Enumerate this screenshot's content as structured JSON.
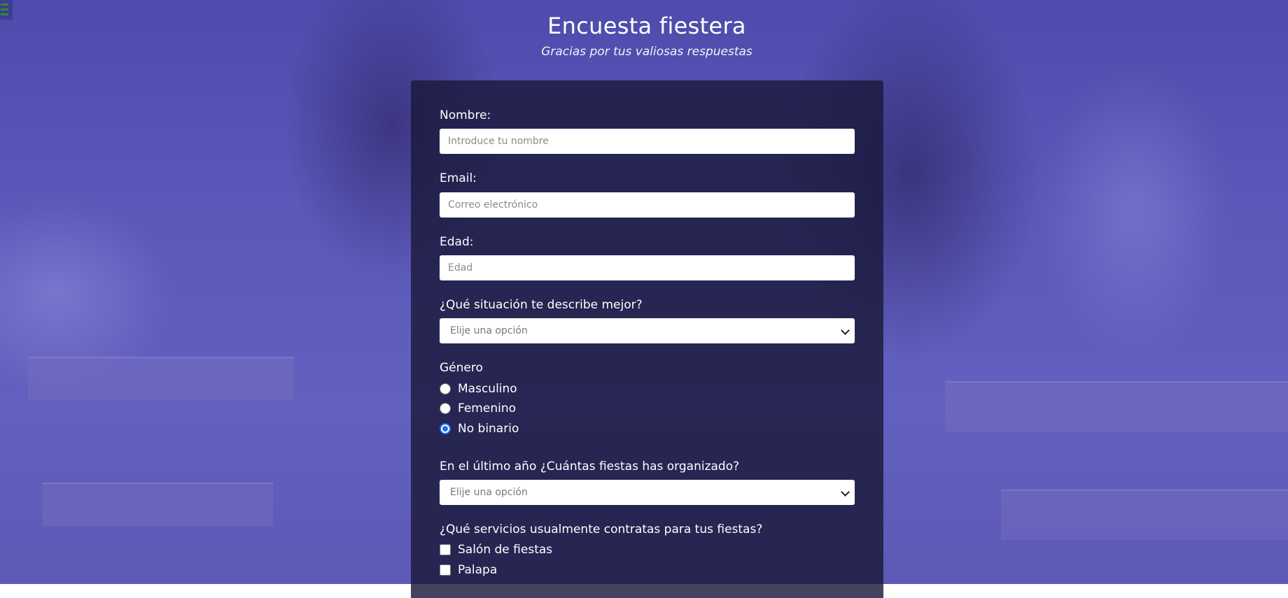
{
  "header": {
    "title": "Encuesta fiestera",
    "subtitle": "Gracias por tus valiosas respuestas"
  },
  "menu": {
    "icon": "hamburger-menu-icon"
  },
  "form": {
    "name": {
      "label": "Nombre:",
      "placeholder": "Introduce tu nombre",
      "value": ""
    },
    "email": {
      "label": "Email:",
      "placeholder": "Correo electrónico",
      "value": ""
    },
    "age": {
      "label": "Edad:",
      "placeholder": "Edad",
      "value": ""
    },
    "situation": {
      "label": "¿Qué situación te describe mejor?",
      "selected": "Elije una opción",
      "icon": "chevron-down-icon"
    },
    "gender": {
      "label": "Género",
      "options": [
        {
          "label": "Masculino",
          "checked": false
        },
        {
          "label": "Femenino",
          "checked": false
        },
        {
          "label": "No binario",
          "checked": true
        }
      ]
    },
    "parties": {
      "label": "En el último año ¿Cuántas fiestas has organizado?",
      "selected": "Elije una opción",
      "icon": "chevron-down-icon"
    },
    "services": {
      "label": "¿Qué servicios usualmente contratas para tus fiestas?",
      "options": [
        {
          "label": "Salón de fiestas",
          "checked": false
        },
        {
          "label": "Palapa",
          "checked": false
        }
      ]
    }
  },
  "colors": {
    "background_tint": "#5a58b8",
    "panel": "#1b1a3c",
    "radio_accent": "#1a73e8"
  }
}
